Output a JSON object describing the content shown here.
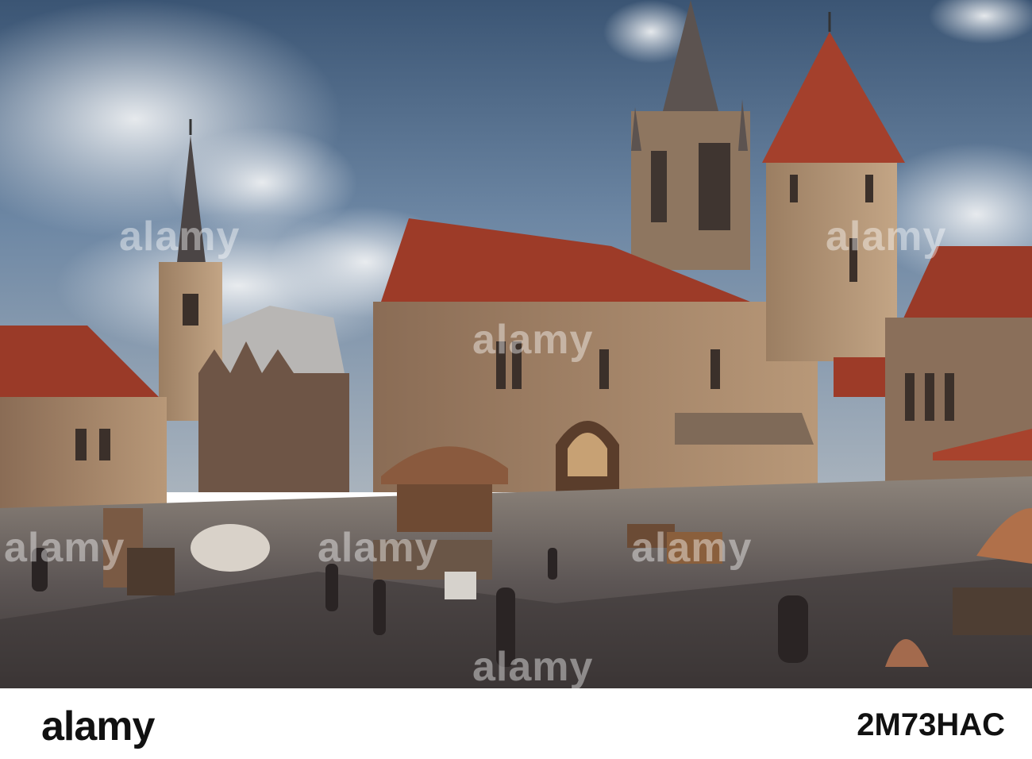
{
  "image": {
    "subject": "medieval-town-square-with-cathedral",
    "colors": {
      "sky_top": "#3f5877",
      "sky_mid": "#7d93ac",
      "roof_red": "#9c3a27",
      "stone": "#a88a6c",
      "cobble": "#5b5453",
      "footer_bg": "#ffffff"
    }
  },
  "watermark": {
    "text": "alamy"
  },
  "footer": {
    "brand": "alamy",
    "stock_id": "2M73HAC"
  }
}
